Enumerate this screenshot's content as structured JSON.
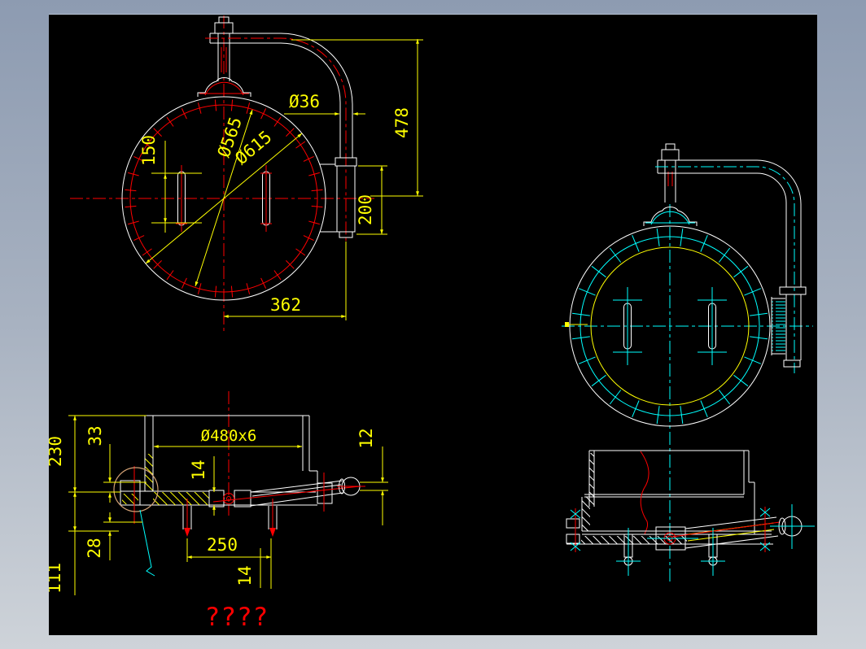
{
  "window": {
    "canvas_background": "#000000",
    "frame_color_top": "#8d9bb1",
    "frame_color_bottom": "#ced3d9"
  },
  "colors": {
    "geometry": "#ffffff",
    "dimension": "#ffff00",
    "centerline_front": "#ff0000",
    "centerline_side": "#00ffff",
    "inner_ring": "#ffff00",
    "detail_circle": "#d4a276",
    "title": "#ff0000"
  },
  "drawing": {
    "front_view": {
      "dim_pipe_diameter": "Ø36",
      "dim_bolt_circle": "Ø565",
      "dim_outer_diameter": "Ø615",
      "dim_height": "478",
      "dim_slot_length": "150",
      "dim_bracket_length": "200",
      "dim_offset": "362"
    },
    "section_view": {
      "dim_total_height": "230",
      "dim_step": "33",
      "dim_shell": "Ø480x6",
      "dim_plate_thickness": "14",
      "dim_handle_end": "12",
      "dim_lower_step": "28",
      "dim_bolt_spacing": "250",
      "dim_lower_offset": "14",
      "dim_bottom_height": "111"
    },
    "title_text": "????"
  }
}
